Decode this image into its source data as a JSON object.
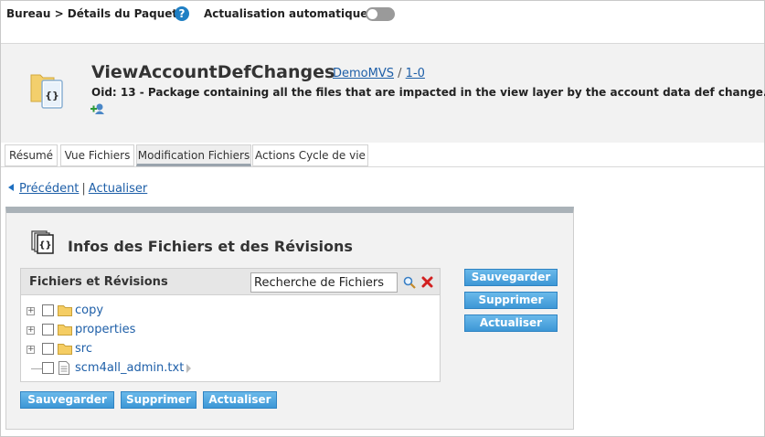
{
  "topbar": {
    "breadcrumb": "Bureau > Détails du Paquet",
    "help_glyph": "?",
    "auto_refresh_label": "Actualisation automatique",
    "auto_refresh_on": false
  },
  "package": {
    "name": "ViewAccountDefChanges",
    "project_link": "DemoMVS",
    "separator": "/",
    "version_link": "1-0",
    "description": "Oid: 13 - Package containing all the files that are impacted in the view layer by the account data def change."
  },
  "tabs": [
    {
      "label": "Résumé",
      "active": false
    },
    {
      "label": "Vue Fichiers",
      "active": false
    },
    {
      "label": "Modification Fichiers",
      "active": true
    },
    {
      "label": "Actions Cycle de vie",
      "active": false
    }
  ],
  "nav": {
    "previous": "Précédent",
    "separator": "|",
    "refresh": "Actualiser"
  },
  "section": {
    "title": "Infos des Fichiers et des Révisions"
  },
  "tree": {
    "header": "Fichiers et Révisions",
    "search_value": "Recherche de Fichiers",
    "items": [
      {
        "label": "copy",
        "type": "folder"
      },
      {
        "label": "properties",
        "type": "folder"
      },
      {
        "label": "src",
        "type": "folder"
      },
      {
        "label": "scm4all_admin.txt",
        "type": "file"
      }
    ]
  },
  "buttons": {
    "save": "Sauvegarder",
    "delete": "Supprimer",
    "refresh": "Actualiser"
  },
  "colors": {
    "accent": "#3d97d6",
    "link": "#1e5fa8",
    "panel": "#f2f2f2"
  },
  "icons": [
    "help-icon",
    "package-icon",
    "add-user-icon",
    "back-arrow-icon",
    "files-icon",
    "search-icon",
    "clear-icon",
    "folder-icon",
    "file-icon"
  ]
}
